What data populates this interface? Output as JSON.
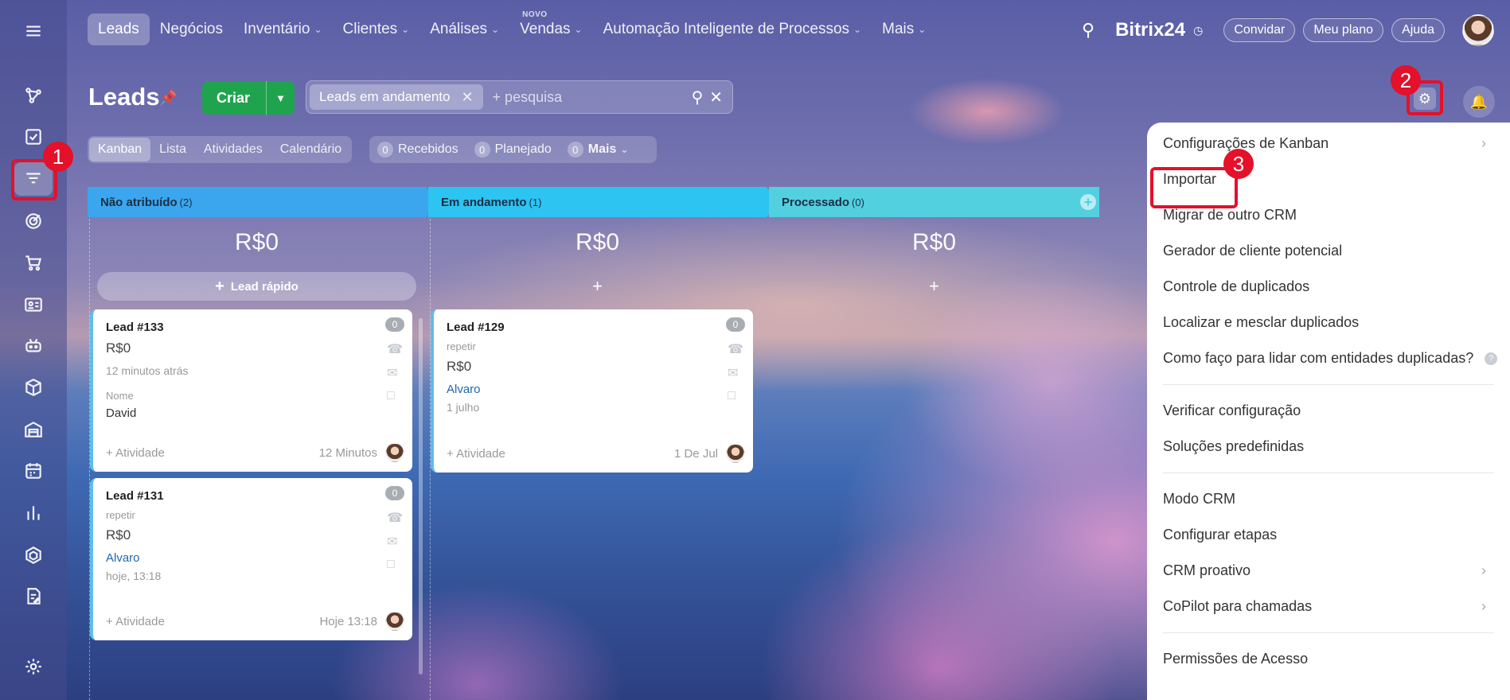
{
  "topnav": {
    "items": [
      {
        "label": "Leads",
        "active": true,
        "dropdown": false
      },
      {
        "label": "Negócios",
        "dropdown": false
      },
      {
        "label": "Inventário",
        "dropdown": true
      },
      {
        "label": "Clientes",
        "dropdown": true
      },
      {
        "label": "Análises",
        "dropdown": true
      },
      {
        "label": "Vendas",
        "dropdown": true,
        "badge": "NOVO"
      },
      {
        "label": "Automação Inteligente de Processos",
        "dropdown": true
      },
      {
        "label": "Mais",
        "dropdown": true
      }
    ],
    "brand": "Bitrix24",
    "buttons": {
      "invite": "Convidar",
      "plan": "Meu plano",
      "help": "Ajuda"
    }
  },
  "header": {
    "title": "Leads",
    "create_label": "Criar",
    "filter_chip": "Leads em andamento",
    "search_placeholder": "+ pesquisa"
  },
  "views": {
    "tabs": [
      "Kanban",
      "Lista",
      "Atividades",
      "Calendário"
    ],
    "counters": [
      {
        "count": "0",
        "label": "Recebidos"
      },
      {
        "count": "0",
        "label": "Planejado"
      },
      {
        "count": "0",
        "label": "Mais"
      }
    ]
  },
  "columns": [
    {
      "name": "Não atribuído",
      "count": "(2)",
      "total": "R$0",
      "color": "#3ba6ee",
      "add_label": "Lead rápido"
    },
    {
      "name": "Em andamento",
      "count": "(1)",
      "total": "R$0",
      "color": "#2dc4f2",
      "add_label": "+"
    },
    {
      "name": "Processado",
      "count": "(0)",
      "total": "R$0",
      "color": "#52d0e0",
      "add_label": "+"
    }
  ],
  "cards": {
    "lead133": {
      "title": "Lead #133",
      "price": "R$0",
      "time": "12 minutos atrás",
      "field_label": "Nome",
      "field_value": "David",
      "badge": "0",
      "activity": "+ Atividade",
      "foot_time": "12 Minutos"
    },
    "lead131": {
      "title": "Lead #131",
      "sub": "repetir",
      "price": "R$0",
      "link": "Alvaro",
      "time": "hoje, 13:18",
      "badge": "0",
      "activity": "+ Atividade",
      "foot_time": "Hoje 13:18"
    },
    "lead129": {
      "title": "Lead #129",
      "sub": "repetir",
      "price": "R$0",
      "link": "Alvaro",
      "time": "1 julho",
      "badge": "0",
      "activity": "+ Atividade",
      "foot_time": "1 De Jul"
    }
  },
  "menu": {
    "items": [
      {
        "label": "Configurações de Kanban",
        "arrow": true
      },
      {
        "label": "Importar"
      },
      {
        "label": "Migrar de outro CRM"
      },
      {
        "label": "Gerador de cliente potencial"
      },
      {
        "label": "Controle de duplicados"
      },
      {
        "label": "Localizar e mesclar duplicados"
      },
      {
        "label": "Como faço para lidar com entidades duplicadas?",
        "help": true
      },
      {
        "separator": true
      },
      {
        "label": "Verificar configuração"
      },
      {
        "label": "Soluções predefinidas"
      },
      {
        "separator": true
      },
      {
        "label": "Modo CRM"
      },
      {
        "label": "Configurar etapas"
      },
      {
        "label": "CRM proativo",
        "arrow": true
      },
      {
        "label": "CoPilot para chamadas",
        "arrow": true
      },
      {
        "separator": true
      },
      {
        "label": "Permissões de Acesso"
      }
    ]
  },
  "annotations": {
    "one": "1",
    "two": "2",
    "three": "3"
  },
  "colors": {
    "accent_green": "#1fa44d",
    "highlight_red": "#e5102a",
    "link_blue": "#2067b0"
  }
}
